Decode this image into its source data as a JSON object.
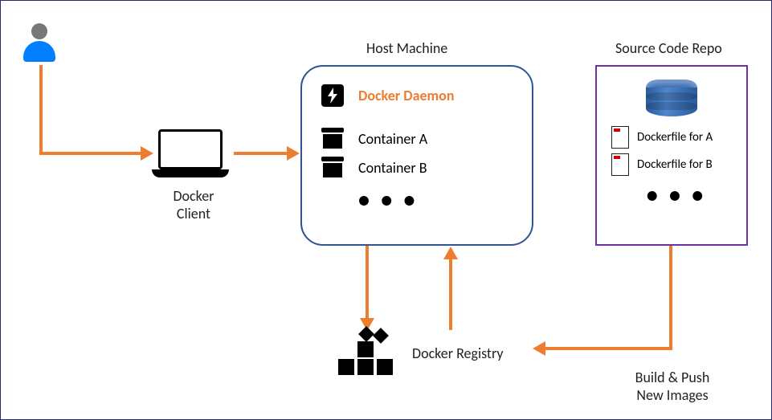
{
  "titles": {
    "host": "Host Machine",
    "repo": "Source Code Repo"
  },
  "client": {
    "label_line1": "Docker",
    "label_line2": "Client"
  },
  "host": {
    "daemon_label": "Docker Daemon",
    "container_a_label": "Container A",
    "container_b_label": "Container B",
    "ellipsis": "• • •"
  },
  "repo": {
    "file_a": "Dockerfile for A",
    "file_b": "Dockerfile for B",
    "ellipsis": "• • •"
  },
  "registry": {
    "label": "Docker Registry"
  },
  "build_push": {
    "line1": "Build & Push",
    "line2": "New Images"
  }
}
